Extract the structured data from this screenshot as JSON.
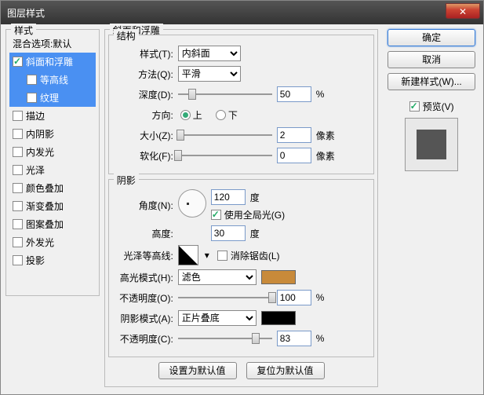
{
  "window_title": "图层样式",
  "sidebar": {
    "header": "样式",
    "items": [
      {
        "label": "混合选项:默认",
        "checked": null
      },
      {
        "label": "斜面和浮雕",
        "checked": true,
        "selected": true
      },
      {
        "label": "等高线",
        "checked": false,
        "sub": true,
        "selected": true
      },
      {
        "label": "纹理",
        "checked": false,
        "sub": true,
        "selected": true
      },
      {
        "label": "描边",
        "checked": false
      },
      {
        "label": "内阴影",
        "checked": false
      },
      {
        "label": "内发光",
        "checked": false
      },
      {
        "label": "光泽",
        "checked": false
      },
      {
        "label": "颜色叠加",
        "checked": false
      },
      {
        "label": "渐变叠加",
        "checked": false
      },
      {
        "label": "图案叠加",
        "checked": false
      },
      {
        "label": "外发光",
        "checked": false
      },
      {
        "label": "投影",
        "checked": false
      }
    ]
  },
  "main": {
    "title": "斜面和浮雕",
    "structure": {
      "legend": "结构",
      "style_label": "样式(T):",
      "style_value": "内斜面",
      "method_label": "方法(Q):",
      "method_value": "平滑",
      "depth_label": "深度(D):",
      "depth_value": "50",
      "depth_unit": "%",
      "direction_label": "方向:",
      "dir_up": "上",
      "dir_down": "下",
      "size_label": "大小(Z):",
      "size_value": "2",
      "size_unit": "像素",
      "soften_label": "软化(F):",
      "soften_value": "0",
      "soften_unit": "像素"
    },
    "shading": {
      "legend": "阴影",
      "angle_label": "角度(N):",
      "angle_value": "120",
      "angle_unit": "度",
      "global_light": "使用全局光(G)",
      "altitude_label": "高度:",
      "altitude_value": "30",
      "altitude_unit": "度",
      "gloss_label": "光泽等高线:",
      "antialias": "消除锯齿(L)",
      "hmode_label": "高光模式(H):",
      "hmode_value": "滤色",
      "hcolor": "#c88a3a",
      "hopacity_label": "不透明度(O):",
      "hopacity_value": "100",
      "hopacity_unit": "%",
      "smode_label": "阴影模式(A):",
      "smode_value": "正片叠底",
      "scolor": "#000000",
      "sopacity_label": "不透明度(C):",
      "sopacity_value": "83",
      "sopacity_unit": "%"
    },
    "set_default": "设置为默认值",
    "reset_default": "复位为默认值"
  },
  "right": {
    "ok": "确定",
    "cancel": "取消",
    "new_style": "新建样式(W)...",
    "preview": "预览(V)"
  }
}
